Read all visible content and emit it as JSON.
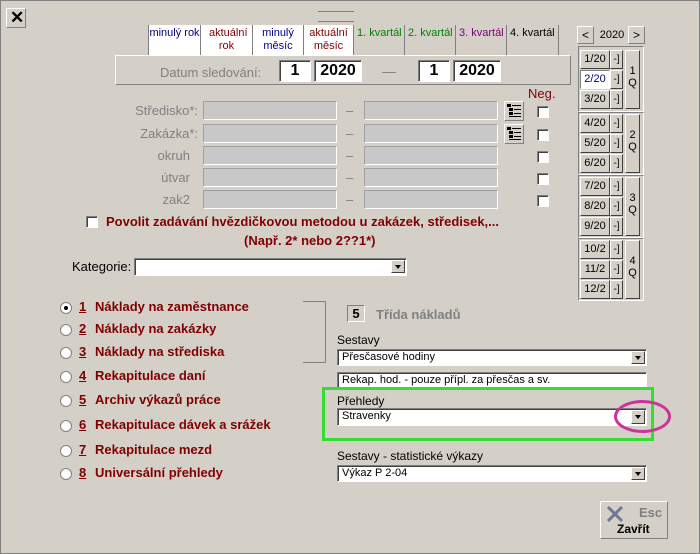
{
  "window": {
    "close_glyph": "✕"
  },
  "tabs": [
    {
      "label": "minulý rok",
      "color": "#000080"
    },
    {
      "label": "aktuální rok",
      "color": "#800000"
    },
    {
      "label": "minulý měsíc",
      "color": "#000080"
    },
    {
      "label": "aktuální měsíc",
      "color": "#800000"
    },
    {
      "label": "1. kvartál",
      "color": "#008000"
    },
    {
      "label": "2. kvartál",
      "color": "#008000"
    },
    {
      "label": "3. kvartál",
      "color": "#800080"
    },
    {
      "label": "4. kvartál",
      "color": "#000000"
    }
  ],
  "period": {
    "label": "Datum sledování:",
    "from_month": "1",
    "from_year": "2020",
    "separator": "—",
    "to_month": "1",
    "to_year": "2020"
  },
  "filters": {
    "neg_label": "Neg.",
    "rows": [
      {
        "label": "Středisko*:"
      },
      {
        "label": "Zakázka*:"
      },
      {
        "label": "okruh"
      },
      {
        "label": "útvar"
      },
      {
        "label": "zak2"
      }
    ],
    "dash": "–"
  },
  "star_method": {
    "label": "Povolit zadávání hvězdičkovou metodou u zakázek, středisek,...",
    "hint": "(Např. 2* nebo 2??1*)"
  },
  "category": {
    "label": "Kategorie:",
    "value": ""
  },
  "reports": [
    {
      "num": "1",
      "label": "Náklady na zaměstnance",
      "selected": true
    },
    {
      "num": "2",
      "label": "Náklady na zakázky",
      "selected": false
    },
    {
      "num": "3",
      "label": "Náklady na střediska",
      "selected": false
    },
    {
      "num": "4",
      "label": "Rekapitulace daní",
      "selected": false
    },
    {
      "num": "5",
      "label": "Archiv výkazů práce",
      "selected": false
    },
    {
      "num": "6",
      "label": "Rekapitulace dávek a srážek",
      "selected": false
    },
    {
      "num": "7",
      "label": "Rekapitulace mezd",
      "selected": false
    },
    {
      "num": "8",
      "label": "Universální přehledy",
      "selected": false
    }
  ],
  "cost_class": {
    "value": "5",
    "label": "Třída nákladů"
  },
  "sestavy": {
    "label": "Sestavy",
    "value1": "Přesčasové hodiny",
    "value2": "Rekap. hod. - pouze přípl. za přesčas a sv."
  },
  "prehledy": {
    "label": "Přehledy",
    "value": "Stravenky"
  },
  "stat": {
    "label": "Sestavy - statistické výkazy",
    "value": "Výkaz P 2-04"
  },
  "close": {
    "esc": "Esc",
    "label": "Zavřít"
  },
  "calendar": {
    "prev": "<",
    "next": ">",
    "year": "2020",
    "months": [
      "1/20",
      "2/20",
      "3/20",
      "4/20",
      "5/20",
      "6/20",
      "7/20",
      "8/20",
      "9/20",
      "10/2",
      "11/2",
      "12/2"
    ],
    "dash": "-]",
    "quarters": [
      "1 Q",
      "2 Q",
      "3 Q",
      "4 Q"
    ]
  },
  "highlight_color": "#33dd33",
  "circle_color": "#cc3399"
}
